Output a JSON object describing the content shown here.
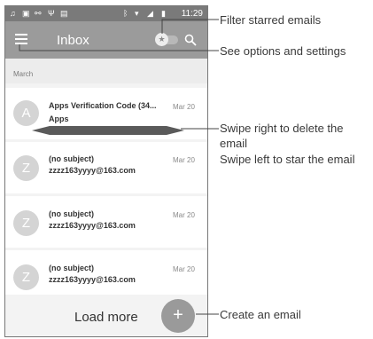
{
  "status_bar": {
    "left_icons": [
      "notification-icon",
      "image-icon",
      "usb-icon",
      "usb-debug-icon",
      "message-icon"
    ],
    "right_icons": [
      "bluetooth-icon",
      "wifi-icon",
      "signal-icon",
      "battery-icon"
    ],
    "time": "11:29"
  },
  "toolbar": {
    "title": "Inbox",
    "menu_icon": "menu-icon",
    "star_filter_icon": "star-icon",
    "search_icon": "search-icon"
  },
  "section": {
    "label": "March"
  },
  "emails": [
    {
      "avatar": "A",
      "sender": "Apps Verification Code (34...",
      "subject": "Apps",
      "date": "Mar 20"
    },
    {
      "avatar": "Z",
      "sender": "(no subject)",
      "subject": "zzzz163yyyy@163.com",
      "date": "Mar 20"
    },
    {
      "avatar": "Z",
      "sender": "(no subject)",
      "subject": "zzzz163yyyy@163.com",
      "date": "Mar 20"
    },
    {
      "avatar": "Z",
      "sender": "(no subject)",
      "subject": "zzzz163yyyy@163.com",
      "date": "Mar 20"
    }
  ],
  "load_more": {
    "label": "Load more"
  },
  "fab": {
    "label": "+"
  },
  "callouts": {
    "filter_starred": "Filter starred emails",
    "options_settings": "See options and settings",
    "swipe_right": "Swipe right to delete the",
    "swipe_right_cont": "email",
    "swipe_left": "Swipe left to star the email",
    "create_email": "Create an email"
  },
  "colors": {
    "toolbar": "#9b9b9b",
    "status_bar": "#7a7a7a",
    "avatar": "#d4d4d4",
    "fab": "#9a9a9a",
    "background": "#f3f3f3"
  }
}
